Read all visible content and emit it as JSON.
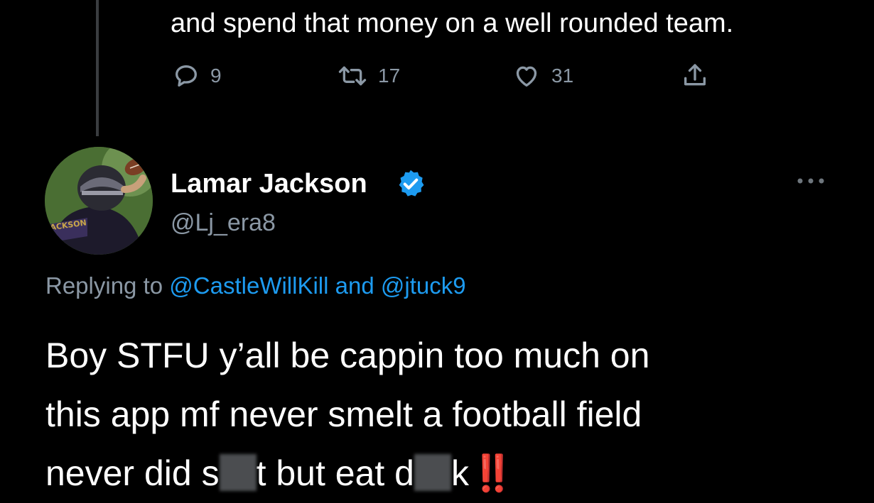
{
  "previous_tweet": {
    "text": "and spend that money on a well rounded team.",
    "actions": {
      "replies": "9",
      "retweets": "17",
      "likes": "31"
    }
  },
  "tweet": {
    "display_name": "Lamar Jackson",
    "verified": true,
    "handle": "@Lj_era8",
    "replying_prefix": "Replying to",
    "replying_mention_1": "@CastleWillKill",
    "replying_and": "and",
    "replying_mention_2": "@jtuck9",
    "body": {
      "line1": "Boy STFU y’all be cappin too much on",
      "line2": "this app mf never smelt a football field",
      "line3_a": "never did s",
      "line3_b": "t but eat d",
      "line3_c": "k",
      "line3_emoji": "‼️"
    }
  },
  "icons": {
    "reply": "reply-icon",
    "retweet": "retweet-icon",
    "like": "heart-icon",
    "share": "share-icon",
    "verified": "verified-badge-icon",
    "more": "more-options-icon"
  },
  "colors": {
    "background": "#000000",
    "secondary_text": "#8b98a5",
    "mention": "#1d9bf0",
    "verified": "#1d9bf0",
    "emoji": "#e0241b"
  }
}
